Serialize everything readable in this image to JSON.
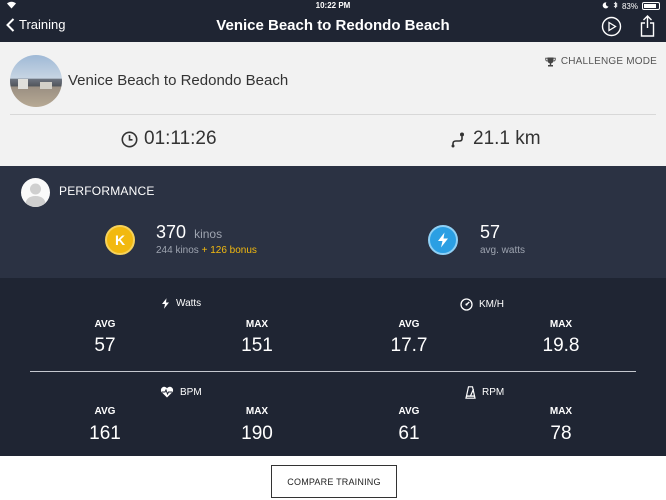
{
  "status_bar": {
    "time": "10:22 PM",
    "battery": "83%",
    "battery_level": 0.83
  },
  "nav": {
    "back_label": "Training",
    "title": "Venice Beach to Redondo Beach"
  },
  "route": {
    "name": "Venice Beach to Redondo Beach",
    "challenge_label": "CHALLENGE MODE",
    "duration": "01:11:26",
    "distance": "21.1 km"
  },
  "performance": {
    "title": "PERFORMANCE",
    "kinos": {
      "value": "370",
      "unit": "kinos",
      "base": "244 kinos",
      "bonus": "+ 126 bonus",
      "icon_letter": "K"
    },
    "watts": {
      "value": "57",
      "label": "avg. watts"
    }
  },
  "stats": {
    "watts": {
      "title": "Watts",
      "avg_label": "AVG",
      "avg": "57",
      "max_label": "MAX",
      "max": "151"
    },
    "kmh": {
      "title": "KM/H",
      "avg_label": "AVG",
      "avg": "17.7",
      "max_label": "MAX",
      "max": "19.8"
    },
    "bpm": {
      "title": "BPM",
      "avg_label": "AVG",
      "avg": "161",
      "max_label": "MAX",
      "max": "190"
    },
    "rpm": {
      "title": "RPM",
      "avg_label": "AVG",
      "avg": "61",
      "max_label": "MAX",
      "max": "78"
    }
  },
  "footer": {
    "compare_label": "COMPARE TRAINING"
  },
  "colors": {
    "nav": "#1f2533",
    "perf": "#2b3243",
    "gold": "#f2b90f",
    "blue": "#2b9fe3"
  }
}
